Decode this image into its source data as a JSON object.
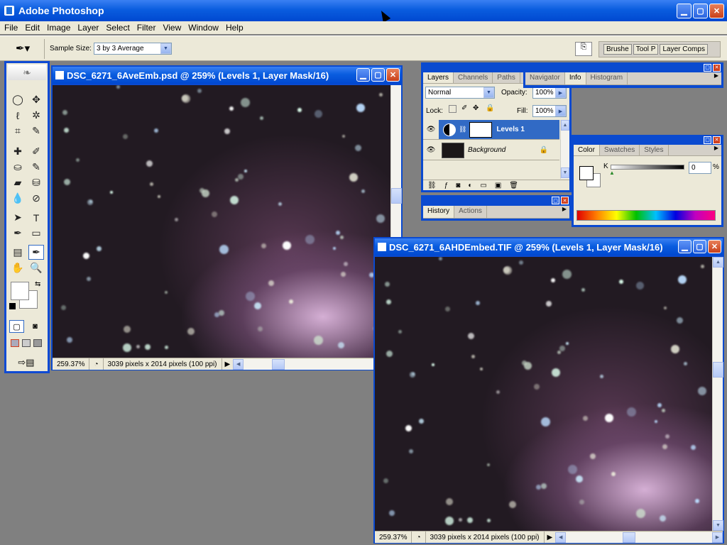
{
  "app": {
    "title": "Adobe Photoshop"
  },
  "menu": [
    "File",
    "Edit",
    "Image",
    "Layer",
    "Select",
    "Filter",
    "View",
    "Window",
    "Help"
  ],
  "options": {
    "sample_size_label": "Sample Size:",
    "sample_size_value": "3 by 3 Average",
    "wells": [
      "Brushe",
      "Tool P",
      "Layer Comps"
    ]
  },
  "doc1": {
    "title": "DSC_6271_6AveEmb.psd @ 259% (Levels 1, Layer Mask/16)",
    "zoom": "259.37%",
    "info": "3039 pixels x 2014 pixels (100 ppi)"
  },
  "doc2": {
    "title": "DSC_6271_6AHDEmbed.TIF @ 259% (Levels 1, Layer Mask/16)",
    "zoom": "259.37%",
    "info": "3039 pixels x 2014 pixels (100 ppi)"
  },
  "layers": {
    "tabs": [
      "Layers",
      "Channels",
      "Paths"
    ],
    "blend": "Normal",
    "opacity_label": "Opacity:",
    "opacity": "100%",
    "lock_label": "Lock:",
    "fill_label": "Fill:",
    "fill": "100%",
    "rows": [
      {
        "name": "Levels 1"
      },
      {
        "name": "Background"
      }
    ]
  },
  "history": {
    "tabs": [
      "History",
      "Actions"
    ]
  },
  "navigator": {
    "tabs": [
      "Navigator",
      "Info",
      "Histogram"
    ]
  },
  "color": {
    "tabs": [
      "Color",
      "Swatches",
      "Styles"
    ],
    "channel": "K",
    "value": "0",
    "unit": "%"
  },
  "colors": {
    "xp_blue": "#0a4ad0",
    "panel_bg": "#ece9d8",
    "selection": "#316ac5"
  }
}
